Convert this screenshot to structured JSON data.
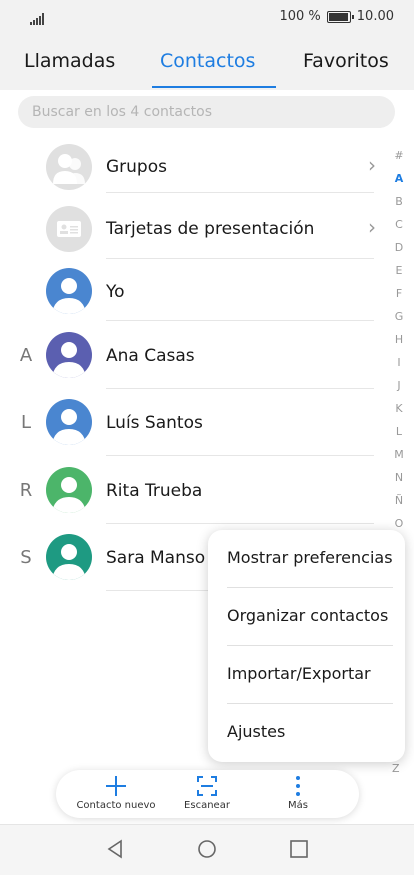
{
  "status": {
    "battery_text": "100 %",
    "time": "10.00"
  },
  "tabs": {
    "calls": "Llamadas",
    "contacts": "Contactos",
    "favorites": "Favoritos"
  },
  "search": {
    "placeholder": "Buscar en los 4 contactos"
  },
  "groups": {
    "label": "Grupos"
  },
  "cards": {
    "label": "Tarjetas de presentación"
  },
  "me": {
    "label": "Yo"
  },
  "contacts": [
    {
      "letter": "A",
      "name": "Ana Casas",
      "color": "#5b5fb0"
    },
    {
      "letter": "L",
      "name": "Luís Santos",
      "color": "#4a86d0"
    },
    {
      "letter": "R",
      "name": "Rita Trueba",
      "color": "#4cb56a"
    },
    {
      "letter": "S",
      "name": "Sara Manso",
      "color": "#1e9a82"
    }
  ],
  "me_color": "#4a86d0",
  "alphabet": [
    "#",
    "A",
    "B",
    "C",
    "D",
    "E",
    "F",
    "G",
    "H",
    "I",
    "J",
    "K",
    "L",
    "M",
    "N",
    "Ñ",
    "O"
  ],
  "alphabet_last": "Z",
  "menu": {
    "items": [
      "Mostrar preferencias",
      "Organizar contactos",
      "Importar/Exportar",
      "Ajustes"
    ]
  },
  "bottom": {
    "new_contact": "Contacto nuevo",
    "scan": "Escanear",
    "more": "Más"
  },
  "accent_color": "#1e7de1"
}
